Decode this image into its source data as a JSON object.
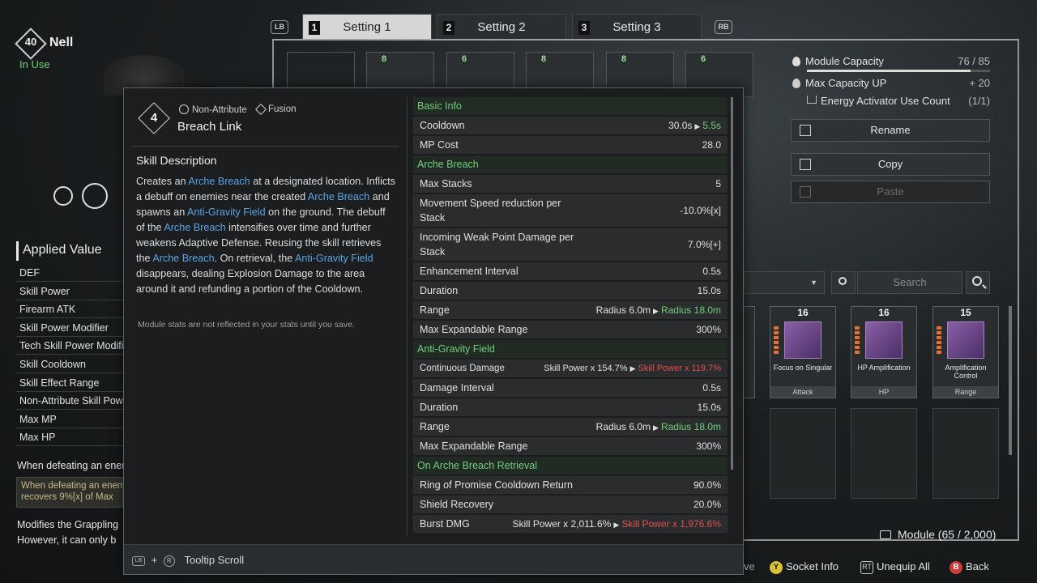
{
  "character": {
    "level": "40",
    "name": "Nell",
    "status": "In Use"
  },
  "tabs": {
    "left_hint": "LB",
    "right_hint": "RB",
    "items": [
      {
        "num": "1",
        "label": "Setting 1"
      },
      {
        "num": "2",
        "label": "Setting 2"
      },
      {
        "num": "3",
        "label": "Setting 3"
      }
    ]
  },
  "top_modules": [
    "8",
    "6",
    "8",
    "8",
    "6"
  ],
  "capacity": {
    "label": "Module Capacity",
    "value": "76 / 85",
    "fill": 0.894,
    "max_up_label": "Max Capacity UP",
    "max_up_value": "+ 20",
    "energy_label": "Energy Activator Use Count",
    "energy_value": "(1/1)"
  },
  "side_buttons": {
    "rename": "Rename",
    "copy": "Copy",
    "paste": "Paste"
  },
  "search": {
    "placeholder": "Search"
  },
  "cards": [
    {
      "cost": "16",
      "name": "Focus on Singular",
      "type": "Attack"
    },
    {
      "cost": "16",
      "name": "HP Amplification",
      "type": "HP"
    },
    {
      "cost": "15",
      "name": "Amplification Control",
      "type": "Range"
    }
  ],
  "applied": {
    "title": "Applied Value",
    "rows": [
      "DEF",
      "Skill Power",
      "Firearm ATK",
      "Skill Power Modifier",
      "Tech Skill Power Modifier",
      "Skill Cooldown",
      "Skill Effect Range",
      "Non-Attribute Skill Power",
      "Max MP",
      "Max HP"
    ],
    "when_title": "When defeating an enemy",
    "when_box_1": "When defeating an enemy",
    "when_box_2": "recovers 9%[x] of Max",
    "modifies_1": "Modifies the Grappling",
    "modifies_2": "However, it can only b"
  },
  "tooltip": {
    "cost": "4",
    "tag1": "Non-Attribute",
    "tag2": "Fusion",
    "name": "Breach Link",
    "desc_title": "Skill Description",
    "desc": {
      "p1": "Creates an ",
      "h1": "Arche Breach",
      "p2": " at a designated location. Inflicts a debuff on enemies near the created ",
      "h2": "Arche Breach",
      "p3": " and spawns an ",
      "h3": "Anti-Gravity Field",
      "p4": " on the ground. The debuff of the ",
      "h4": "Arche Breach",
      "p5": " intensifies over time and further weakens Adaptive Defense. Reusing the skill retrieves the ",
      "h5": "Arche Breach",
      "p6": ". On retrieval, the ",
      "h6": "Anti-Gravity Field",
      "p7": " disappears, dealing Explosion Damage to the area around it and refunding a portion of the Cooldown."
    },
    "note": "Module stats are not reflected in your stats until you save.",
    "sections": {
      "basic": "Basic Info",
      "breach": "Arche Breach",
      "field": "Anti-Gravity Field",
      "retrieval": "On Arche Breach Retrieval"
    },
    "stats": {
      "cooldown": {
        "k": "Cooldown",
        "v": "30.0s",
        "n": "5.5s"
      },
      "mp_cost": {
        "k": "MP Cost",
        "v": "28.0"
      },
      "max_stacks": {
        "k": "Max Stacks",
        "v": "5"
      },
      "move_speed": {
        "k": "Movement Speed reduction per Stack",
        "v": "-10.0%[x]"
      },
      "weak_point": {
        "k": "Incoming Weak Point Damage per Stack",
        "v": "7.0%[+]"
      },
      "enh_interval": {
        "k": "Enhancement Interval",
        "v": "0.5s"
      },
      "duration1": {
        "k": "Duration",
        "v": "15.0s"
      },
      "range1": {
        "k": "Range",
        "v": "Radius 6.0m",
        "n": "Radius 18.0m"
      },
      "max_exp1": {
        "k": "Max Expandable Range",
        "v": "300%"
      },
      "cont_damage": {
        "k": "Continuous Damage",
        "v": "Skill Power x 154.7%",
        "n": "Skill Power x 119.7%"
      },
      "dmg_interval": {
        "k": "Damage Interval",
        "v": "0.5s"
      },
      "duration2": {
        "k": "Duration",
        "v": "15.0s"
      },
      "range2": {
        "k": "Range",
        "v": "Radius 6.0m",
        "n": "Radius 18.0m"
      },
      "max_exp2": {
        "k": "Max Expandable Range",
        "v": "300%"
      },
      "ring": {
        "k": "Ring of Promise Cooldown Return",
        "v": "90.0%"
      },
      "shield": {
        "k": "Shield Recovery",
        "v": "20.0%"
      },
      "burst": {
        "k": "Burst DMG",
        "v": "Skill Power x 2,011.6%",
        "n": "Skill Power x 1,976.6%"
      }
    },
    "footer": {
      "lb": "LB",
      "plus": "+",
      "r": "R",
      "label": "Tooltip Scroll"
    }
  },
  "bottom": {
    "module_count": "Module (65 / 2,000)",
    "save_fragment": "ve",
    "socket_info": "Socket Info",
    "unequip_all": "Unequip All",
    "back": "Back"
  },
  "colors": {
    "green": "#6fcf7a",
    "blue": "#5aa3e6",
    "red": "#e05050"
  }
}
